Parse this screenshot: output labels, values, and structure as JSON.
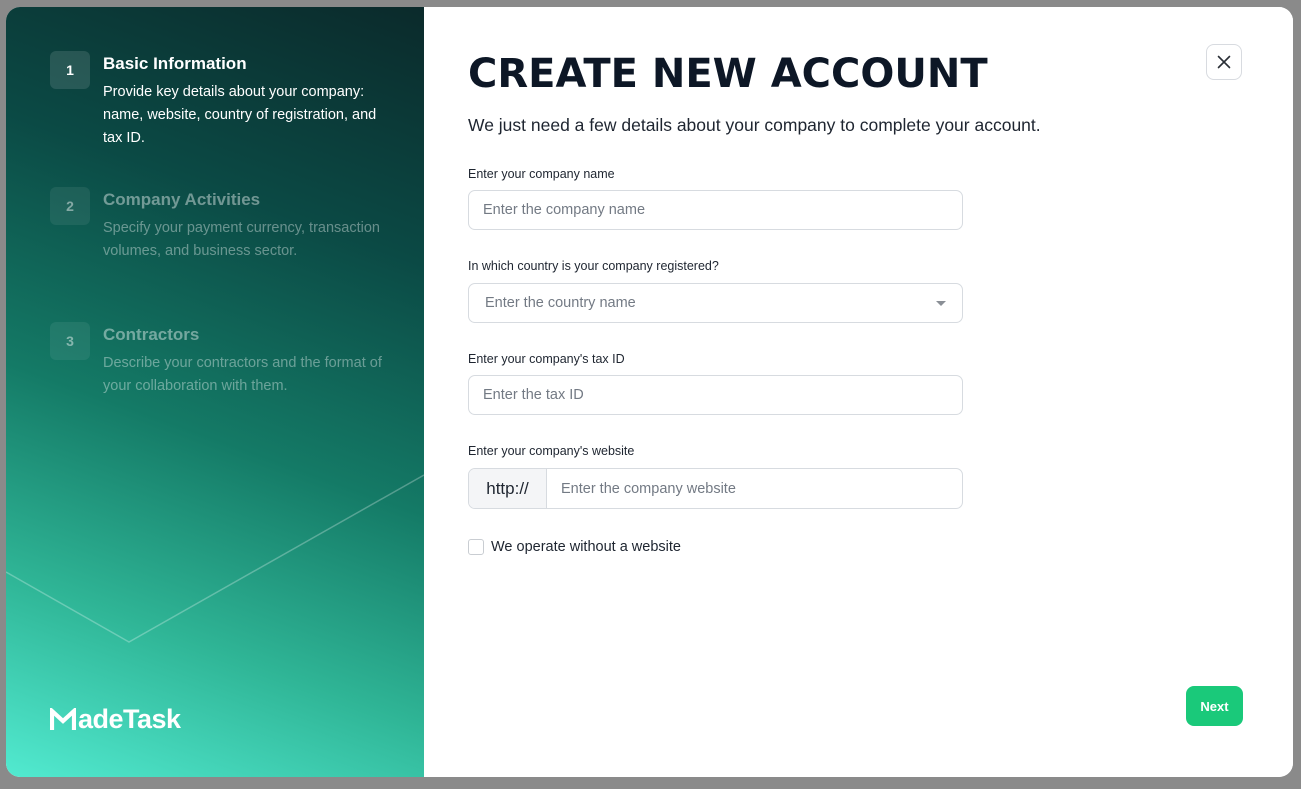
{
  "steps": [
    {
      "number": "1",
      "title": "Basic Information",
      "description": "Provide key details about your company: name, website, country of registration, and tax ID."
    },
    {
      "number": "2",
      "title": "Company Activities",
      "description": "Specify your payment currency, transaction volumes, and business sector."
    },
    {
      "number": "3",
      "title": "Contractors",
      "description": "Describe your contractors and the format of your collaboration with them."
    }
  ],
  "brand": {
    "name": "MadeTask",
    "logo_text": "adeTask",
    "logo_icon": "m-logo-icon"
  },
  "header": {
    "title": "CREATE NEW ACCOUNT",
    "subtitle": "We just need a few details about your company to complete your account.",
    "close_icon": "close-icon"
  },
  "form": {
    "company_name": {
      "label": "Enter your company name",
      "placeholder": "Enter the company name",
      "value": ""
    },
    "country": {
      "label": "In which country is your company registered?",
      "placeholder": "Enter the country name",
      "value": ""
    },
    "tax_id": {
      "label": "Enter your company's tax ID",
      "placeholder": "Enter the tax ID",
      "value": ""
    },
    "website": {
      "label": "Enter your company's website",
      "prefix": "http://",
      "placeholder": "Enter the company website",
      "value": ""
    },
    "no_website": {
      "label": "We operate without a website",
      "checked": false
    }
  },
  "actions": {
    "next_label": "Next"
  },
  "colors": {
    "accent": "#1ac97a",
    "title": "#0d1726",
    "sidebar_dark": "#0b2a2b",
    "sidebar_light": "#52ead0"
  }
}
